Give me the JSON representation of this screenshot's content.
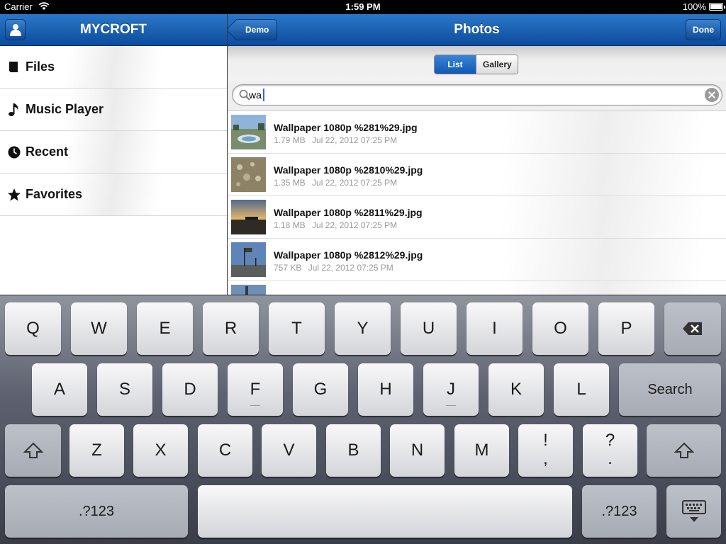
{
  "statusbar": {
    "carrier": "Carrier",
    "time": "1:59 PM",
    "battery": "100%"
  },
  "sidebar": {
    "title": "MYCROFT",
    "items": [
      {
        "label": "Files",
        "icon": "file-icon"
      },
      {
        "label": "Music Player",
        "icon": "music-note-icon"
      },
      {
        "label": "Recent",
        "icon": "clock-icon"
      },
      {
        "label": "Favorites",
        "icon": "star-icon"
      }
    ]
  },
  "main": {
    "title": "Photos",
    "back_label": "Demo",
    "done_label": "Done",
    "segments": {
      "list": "List",
      "gallery": "Gallery",
      "selected": "List"
    },
    "search": {
      "value": "wa"
    },
    "files": [
      {
        "name": "Wallpaper 1080p %281%29.jpg",
        "size": "1.79 MB",
        "date": "Jul 22, 2012 07:25 PM"
      },
      {
        "name": "Wallpaper 1080p %2810%29.jpg",
        "size": "1.35 MB",
        "date": "Jul 22, 2012 07:25 PM"
      },
      {
        "name": "Wallpaper 1080p %2811%29.jpg",
        "size": "1.18 MB",
        "date": "Jul 22, 2012 07:25 PM"
      },
      {
        "name": "Wallpaper 1080p %2812%29.jpg",
        "size": "757 KB",
        "date": "Jul 22, 2012 07:25 PM"
      }
    ]
  },
  "keyboard": {
    "row1": [
      "Q",
      "W",
      "E",
      "R",
      "T",
      "Y",
      "U",
      "I",
      "O",
      "P"
    ],
    "row2": [
      "A",
      "S",
      "D",
      "F",
      "G",
      "H",
      "J",
      "K",
      "L"
    ],
    "row3": [
      "Z",
      "X",
      "C",
      "V",
      "B",
      "N",
      "M"
    ],
    "search_label": "Search",
    "numbers_label": ".?123",
    "exclaim": "!",
    "comma": ",",
    "question": "?",
    "period": "."
  },
  "colors": {
    "navbar": "#1660b0",
    "segment_selected": "#1f6fc7"
  }
}
